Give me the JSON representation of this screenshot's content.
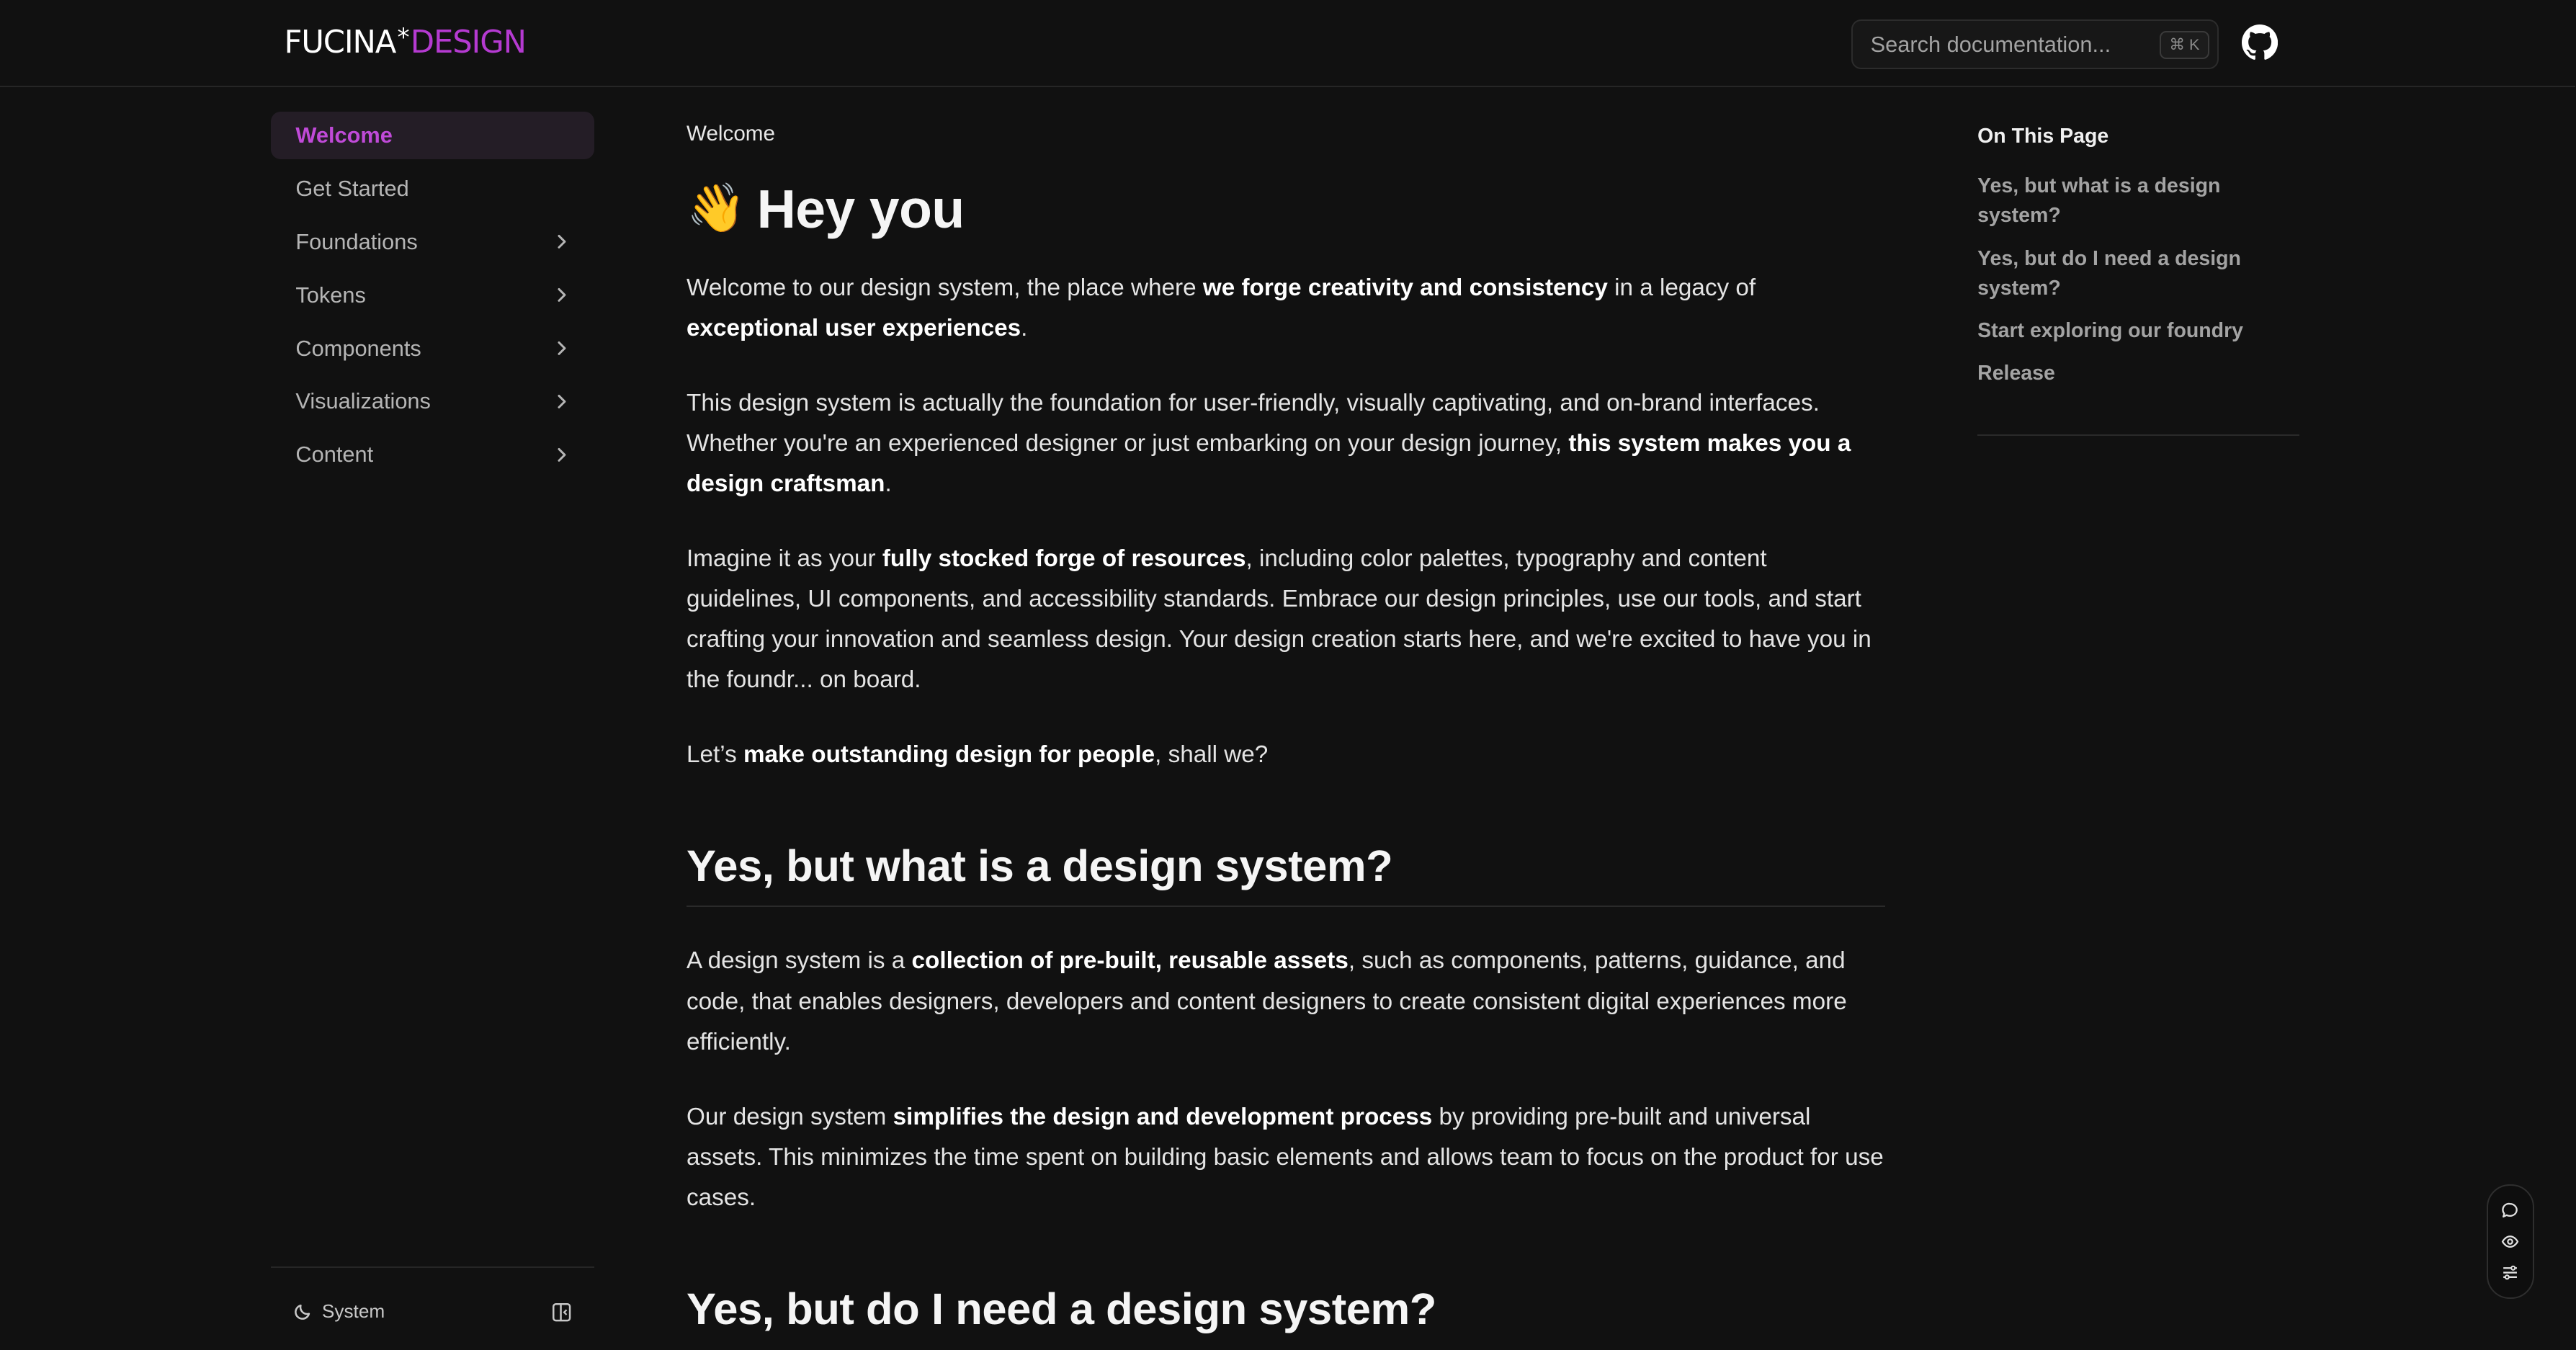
{
  "header": {
    "logo_part1": "FUCINA",
    "logo_star": "*",
    "logo_part2": "DESIGN",
    "search_placeholder": "Search documentation...",
    "search_shortcut": "⌘ K",
    "github_icon": "github-icon"
  },
  "sidebar": {
    "items": [
      {
        "label": "Welcome",
        "active": true
      },
      {
        "label": "Get Started"
      },
      {
        "label": "Foundations",
        "expandable": true
      },
      {
        "label": "Tokens",
        "expandable": true
      },
      {
        "label": "Components",
        "expandable": true
      },
      {
        "label": "Visualizations",
        "expandable": true
      },
      {
        "label": "Content",
        "expandable": true
      }
    ],
    "footer": {
      "theme_label": "System"
    }
  },
  "main": {
    "breadcrumb": "Welcome",
    "title_emoji": "👋",
    "title": "Hey you",
    "p1": {
      "a": "Welcome to our design system, the place where ",
      "b": "we forge creativity and consistency",
      "c": " in a legacy of ",
      "d": "exceptional user experiences",
      "e": "."
    },
    "p2": {
      "a": "This design system is actually the foundation for user-friendly, visually captivating, and on-brand interfaces. Whether you're an experienced designer or just embarking on your design journey, ",
      "b": "this system makes you a design craftsman",
      "c": "."
    },
    "p3": {
      "a": "Imagine it as your ",
      "b": "fully stocked forge of resources",
      "c": ", including color palettes, typography and content guidelines, UI components, and accessibility standards. Embrace our design principles, use our tools, and start crafting your innovation and seamless design. Your design creation starts here, and we're excited to have you in the foundr... on board."
    },
    "p4": {
      "a": "Let’s ",
      "b": "make outstanding design for people",
      "c": ", shall we?"
    },
    "h2_1": "Yes, but what is a design system?",
    "p5": {
      "a": "A design system is a ",
      "b": "collection of pre-built, reusable assets",
      "c": ", such as components, patterns, guidance, and code, that enables designers, developers and content designers to create consistent digital experiences more efficiently."
    },
    "p6": {
      "a": "Our design system ",
      "b": "simplifies the design and development process",
      "c": " by providing pre-built and universal assets. This minimizes the time spent on building basic elements and allows team to focus on the product for use cases."
    },
    "h2_2": "Yes, but do I need a design system?"
  },
  "toc": {
    "title": "On This Page",
    "items": [
      "Yes, but what is a design system?",
      "Yes, but do I need a design system?",
      "Start exploring our foundry",
      "Release"
    ]
  },
  "colors": {
    "accent": "#c04ad8",
    "background": "#111111"
  }
}
